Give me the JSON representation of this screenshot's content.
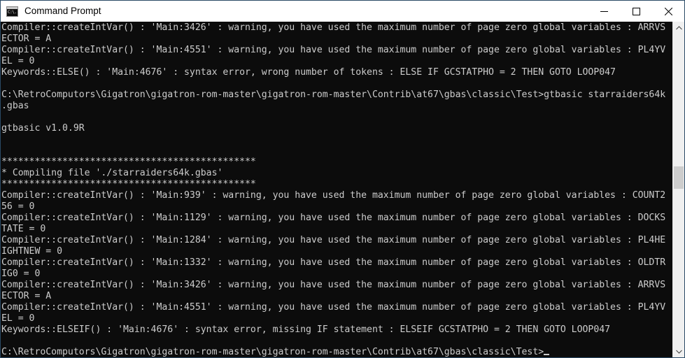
{
  "window": {
    "title": "Command Prompt",
    "icon": "console-icon",
    "icon_glyph": "C:\\.",
    "colors": {
      "titlebar_bg": "#ffffff",
      "console_bg": "#0c0c0c",
      "console_fg": "#cccccc",
      "border": "#2b4a66",
      "scrollbar_track": "#f0f0f0",
      "scrollbar_thumb": "#cdcdcd"
    },
    "controls": {
      "minimize_label": "Minimize",
      "maximize_label": "Maximize",
      "close_label": "Close"
    }
  },
  "scrollbar": {
    "up_arrow": "chevron-up-icon",
    "down_arrow": "chevron-down-icon",
    "thumb_position_percent": 46
  },
  "console": {
    "prompt_path": "C:\\RetroComputors\\Gigatron\\gigatron-rom-master\\gigatron-rom-master\\Contrib\\at67\\gbas\\classic\\Test>",
    "command": "gtbasic starraiders64k.gbas",
    "version": "gtbasic v1.0.9R",
    "banner_rule": "**********************************************",
    "compiling_line": "* Compiling file './starraiders64k.gbas'",
    "cursor": "_",
    "lines": [
      "Compiler::createIntVar() : 'Main:3426' : warning, you have used the maximum number of page zero global variables : ARRVS",
      "ECTOR = A",
      "Compiler::createIntVar() : 'Main:4551' : warning, you have used the maximum number of page zero global variables : PL4YV",
      "EL = 0",
      "Keywords::ELSE() : 'Main:4676' : syntax error, wrong number of tokens : ELSE IF GCSTATPHO = 2 THEN GOTO LOOP047",
      "",
      "C:\\RetroComputors\\Gigatron\\gigatron-rom-master\\gigatron-rom-master\\Contrib\\at67\\gbas\\classic\\Test>gtbasic starraiders64k",
      ".gbas",
      "",
      "gtbasic v1.0.9R",
      "",
      "",
      "**********************************************",
      "* Compiling file './starraiders64k.gbas'",
      "**********************************************",
      "Compiler::createIntVar() : 'Main:939' : warning, you have used the maximum number of page zero global variables : COUNT2",
      "56 = 0",
      "Compiler::createIntVar() : 'Main:1129' : warning, you have used the maximum number of page zero global variables : DOCKS",
      "TATE = 0",
      "Compiler::createIntVar() : 'Main:1284' : warning, you have used the maximum number of page zero global variables : PL4HE",
      "IGHTNEW = 0",
      "Compiler::createIntVar() : 'Main:1332' : warning, you have used the maximum number of page zero global variables : OLDTR",
      "IG0 = 0",
      "Compiler::createIntVar() : 'Main:3426' : warning, you have used the maximum number of page zero global variables : ARRVS",
      "ECTOR = A",
      "Compiler::createIntVar() : 'Main:4551' : warning, you have used the maximum number of page zero global variables : PL4YV",
      "EL = 0",
      "Keywords::ELSEIF() : 'Main:4676' : syntax error, missing IF statement : ELSEIF GCSTATPHO = 2 THEN GOTO LOOP047",
      "",
      "C:\\RetroComputors\\Gigatron\\gigatron-rom-master\\gigatron-rom-master\\Contrib\\at67\\gbas\\classic\\Test>"
    ]
  }
}
